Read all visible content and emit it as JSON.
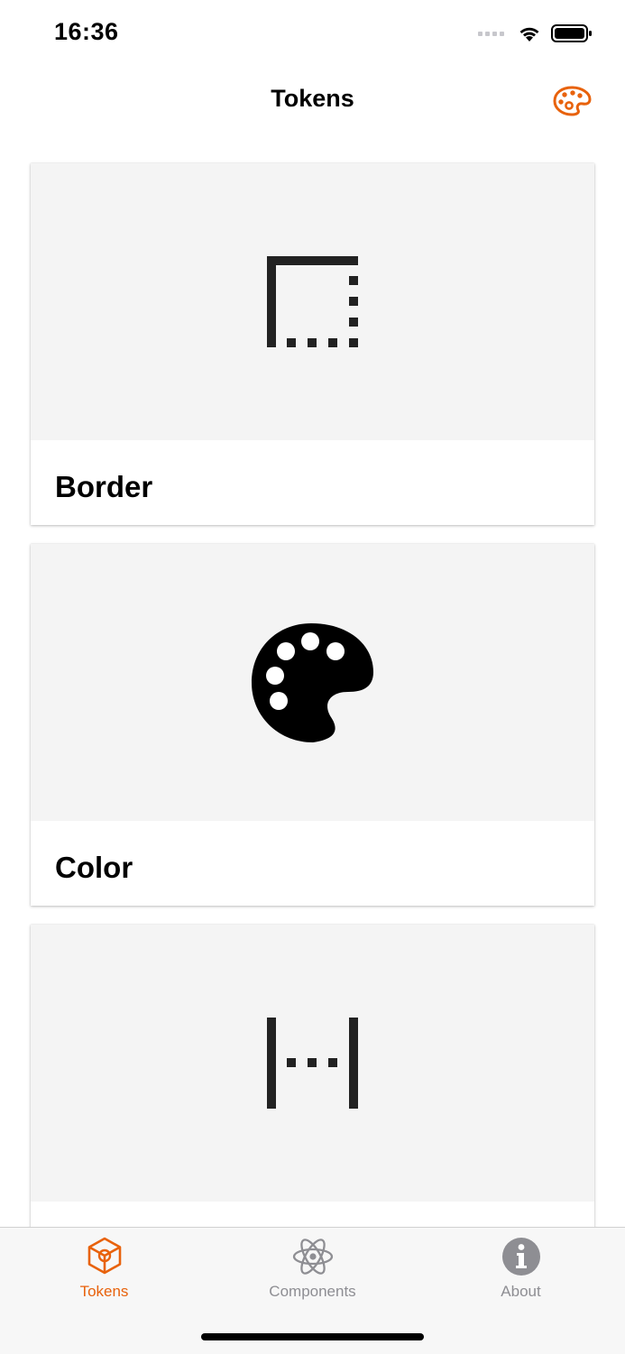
{
  "status": {
    "time": "16:36"
  },
  "nav": {
    "title": "Tokens"
  },
  "cards": [
    {
      "label": "Border",
      "icon": "border-icon"
    },
    {
      "label": "Color",
      "icon": "palette-icon"
    },
    {
      "label": "",
      "icon": "spacing-icon"
    }
  ],
  "tabs": [
    {
      "label": "Tokens",
      "icon": "cube-icon",
      "active": true
    },
    {
      "label": "Components",
      "icon": "atom-icon",
      "active": false
    },
    {
      "label": "About",
      "icon": "info-icon",
      "active": false
    }
  ],
  "colors": {
    "accent": "#e8620c",
    "inactive": "#8e8e93",
    "card_image_bg": "#f4f4f4"
  }
}
